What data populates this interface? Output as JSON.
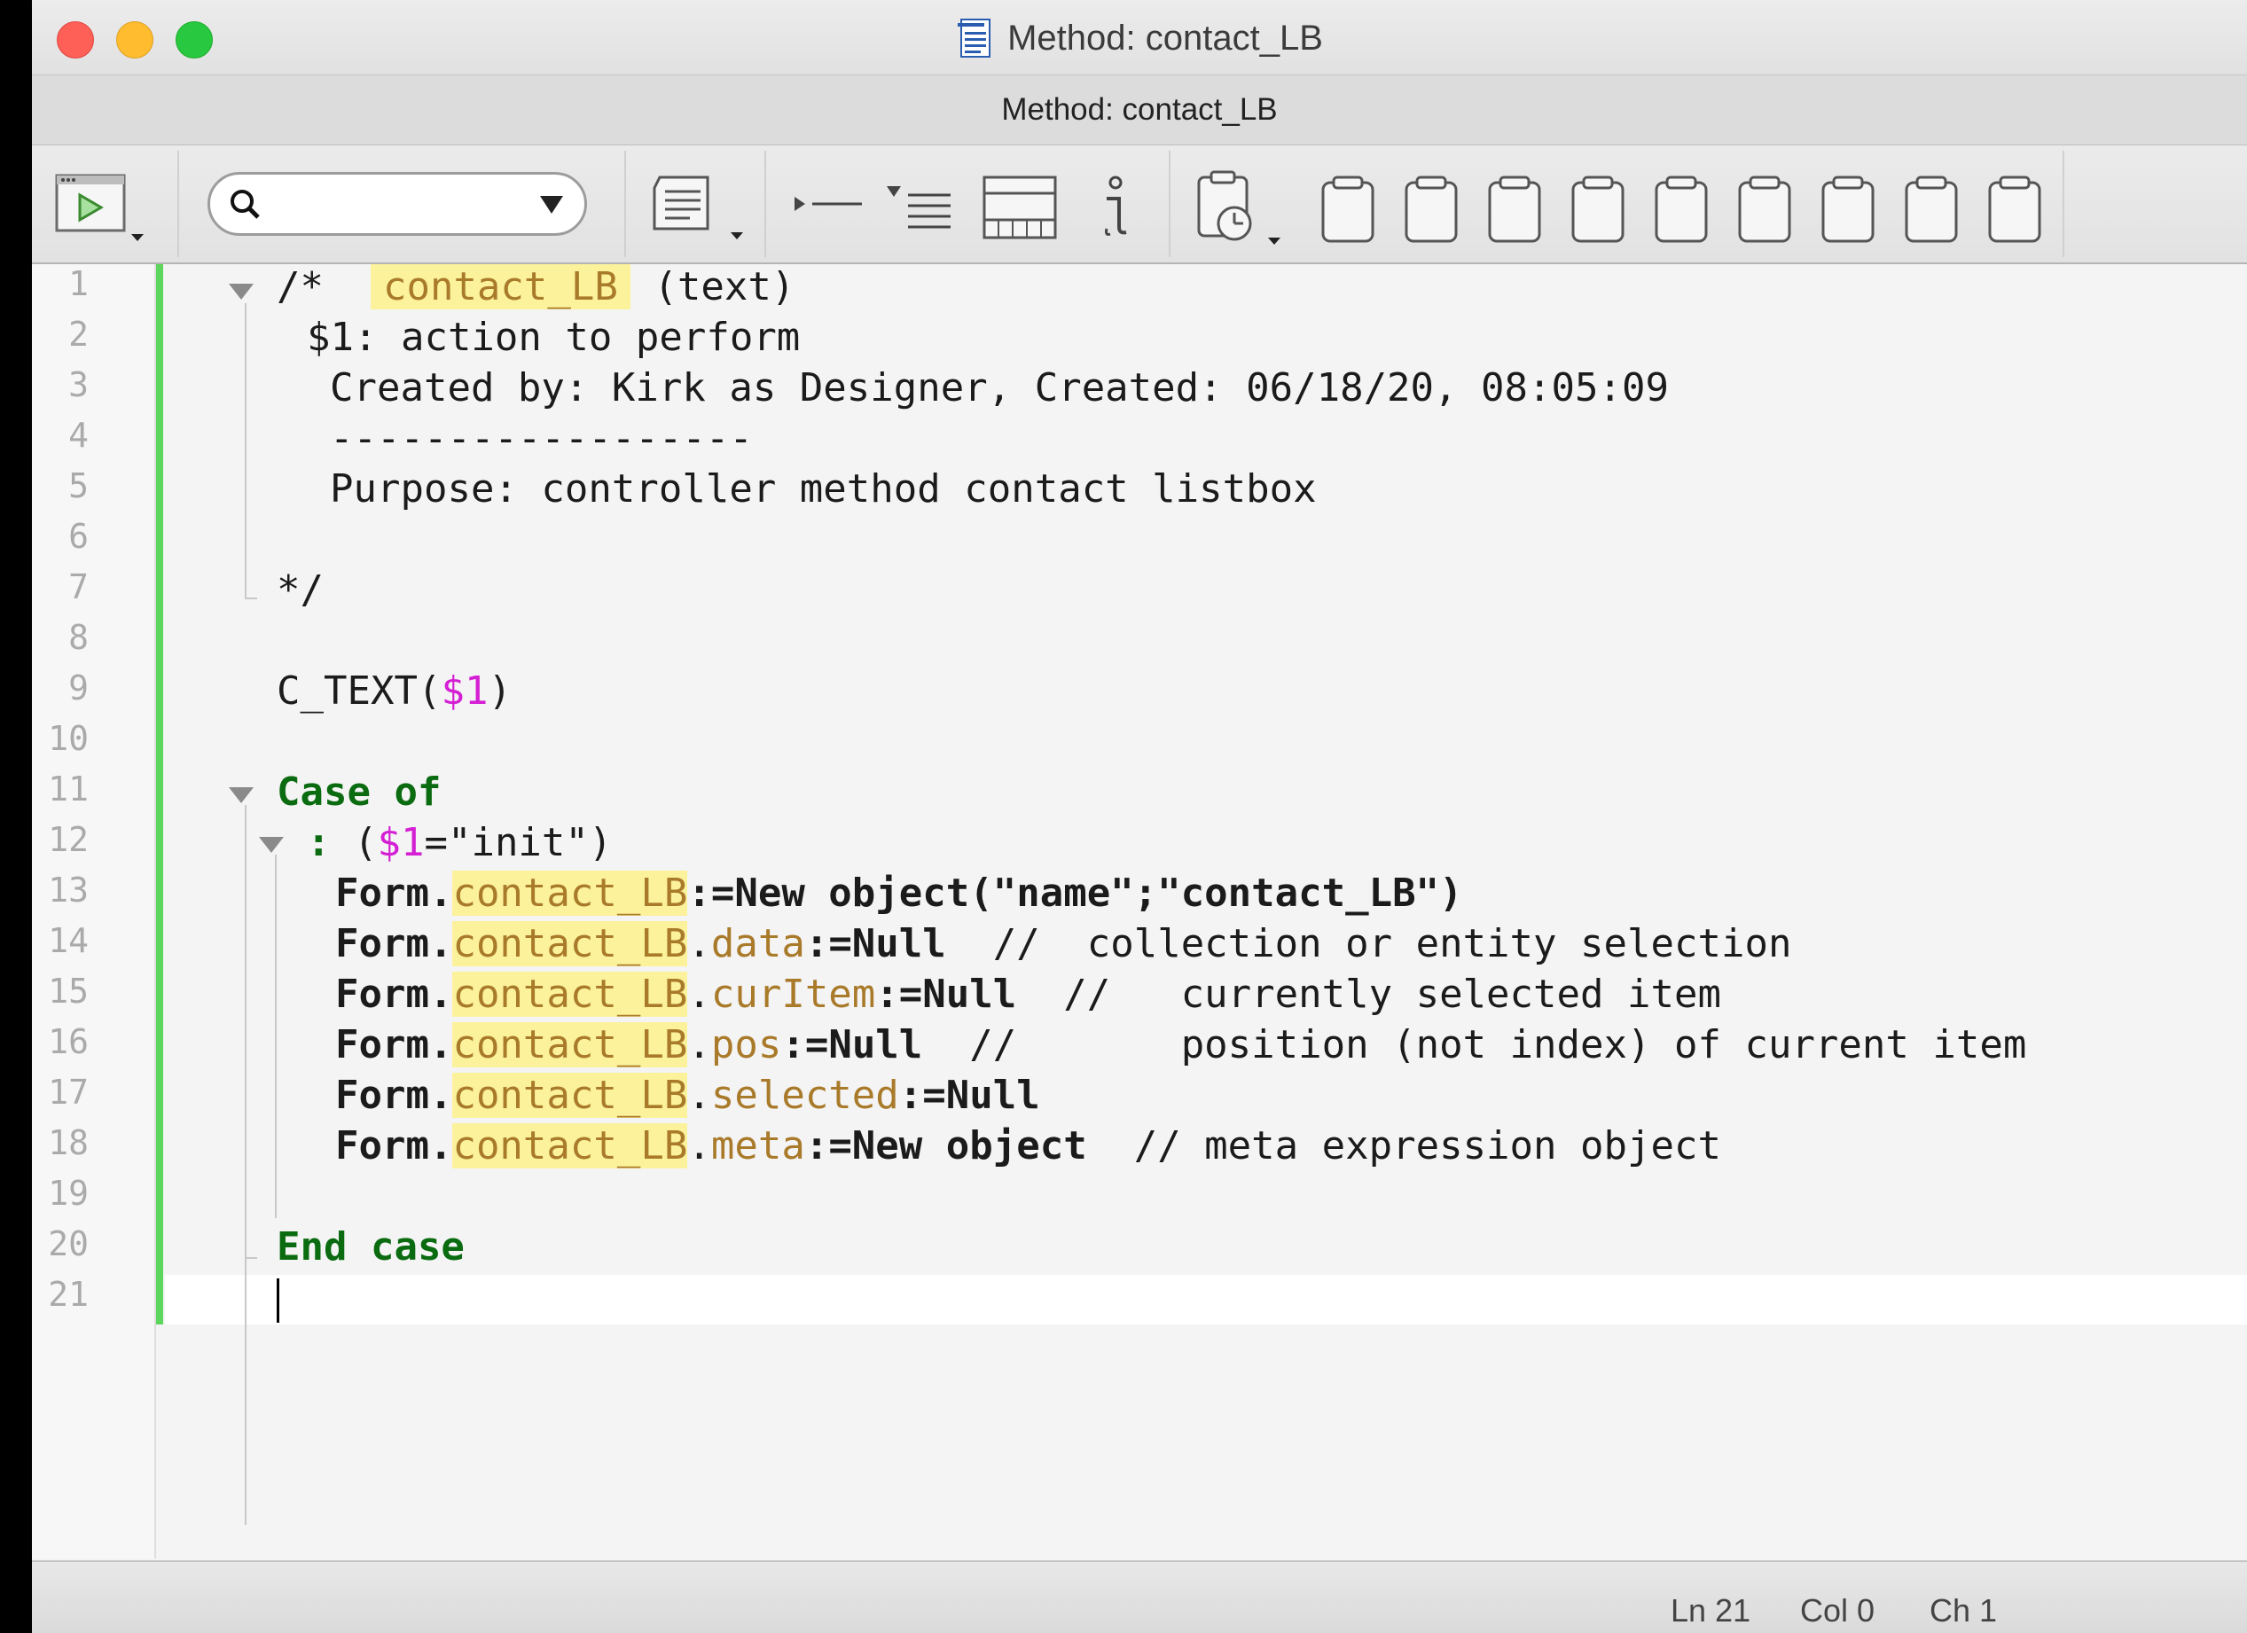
{
  "window": {
    "title": "Method: contact_LB",
    "subtitle": "Method: contact_LB",
    "icon": "method-document-icon"
  },
  "toolbar": {
    "run_icon": "run-method-icon",
    "search_placeholder": "",
    "tools": [
      "method-properties-icon",
      "breakpoint-icon",
      "indent-list-icon",
      "table-grid-icon",
      "info-icon",
      "history-clipboard-icon",
      "clipboard-icon"
    ],
    "clipboard_count": 9
  },
  "editor": {
    "line_numbers": [
      "1",
      "2",
      "3",
      "4",
      "5",
      "6",
      "7",
      "8",
      "9",
      "10",
      "11",
      "12",
      "13",
      "14",
      "15",
      "16",
      "17",
      "18",
      "19",
      "20",
      "21"
    ],
    "comment": {
      "open": "/*",
      "name": "contact_LB",
      "type": "(text)",
      "param": "$1: action to perform",
      "created": "Created by: Kirk as Designer, Created: 06/18/20, 08:05:09",
      "divider": "------------------",
      "purpose": "Purpose: controller method contact listbox",
      "close": "*/"
    },
    "call_fn": "C_TEXT",
    "call_arg": "$1",
    "case_of": "Case of",
    "case_colon": ":",
    "case_var": "$1",
    "case_value": "=\"init\")",
    "form": "Form.",
    "object_name": "contact_LB",
    "line13_rest": ":=New object(\"name\";\"contact_LB\")",
    "prop_data": "data",
    "prop_curItem": "curItem",
    "prop_pos": "pos",
    "prop_selected": "selected",
    "prop_meta": "meta",
    "assign_null": ":=Null",
    "assign_new_object": ":=New object",
    "comment_data": "//  collection or entity selection",
    "comment_curItem": "//   currently selected item",
    "comment_pos": "//       position (not index) of current item",
    "comment_meta": "// meta expression object",
    "end_case": "End case"
  },
  "status": {
    "ln": "Ln 21",
    "col": "Col 0",
    "ch": "Ch 1"
  },
  "colors": {
    "keyword": "#0b6b10",
    "variable": "#d41fd4",
    "field": "#a97a2a",
    "highlight": "#fbf29b",
    "modified_bar": "#5dd65d"
  }
}
